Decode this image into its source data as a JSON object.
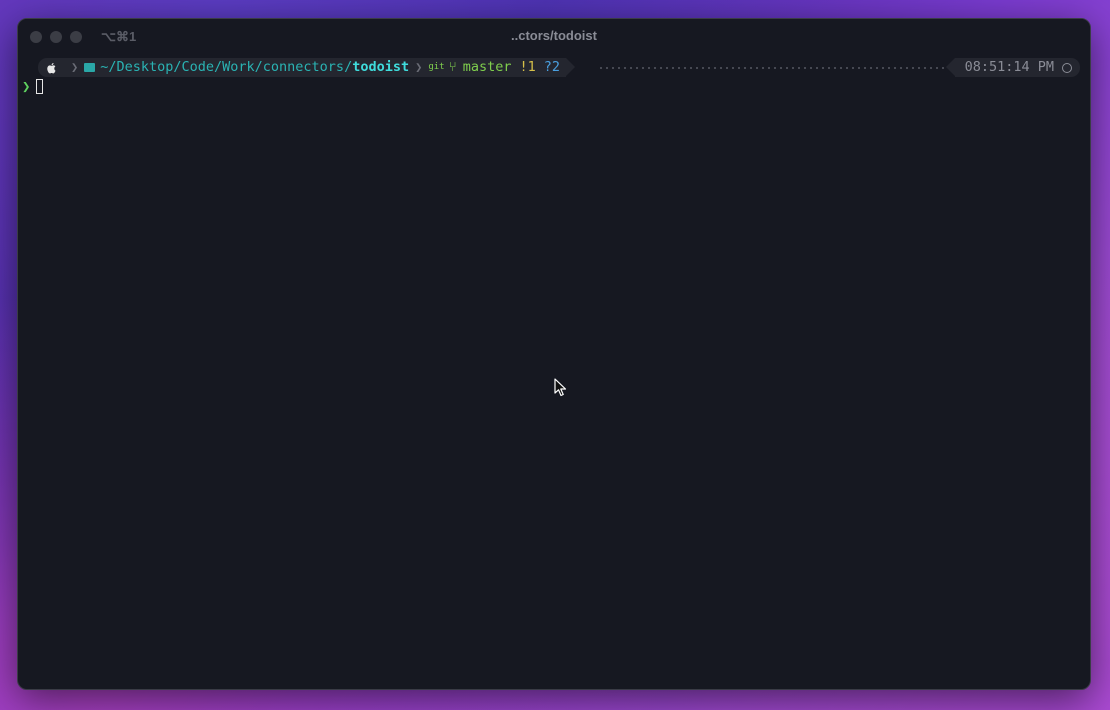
{
  "window": {
    "shortcut": "⌥⌘1",
    "title": "..ctors/todoist"
  },
  "prompt": {
    "path_prefix": "~/Desktop/Code/Work/connectors/",
    "path_current": "todoist",
    "git_label": "git",
    "branch": "master",
    "modified": "!1",
    "untracked": "?2",
    "time": "08:51:14 PM"
  },
  "command_line": {
    "prompt_symbol": "❯",
    "input": ""
  },
  "icons": {
    "apple": "apple-logo-icon",
    "folder": "folder-icon",
    "branch": "git-branch-icon",
    "clock": "clock-icon",
    "pointer": "mouse-pointer-icon"
  },
  "colors": {
    "background": "#161821",
    "path": "#2ab3b3",
    "branch": "#7fce4d",
    "modified": "#d6c04a",
    "untracked": "#4aa0e0",
    "prompt": "#5fd05f"
  }
}
